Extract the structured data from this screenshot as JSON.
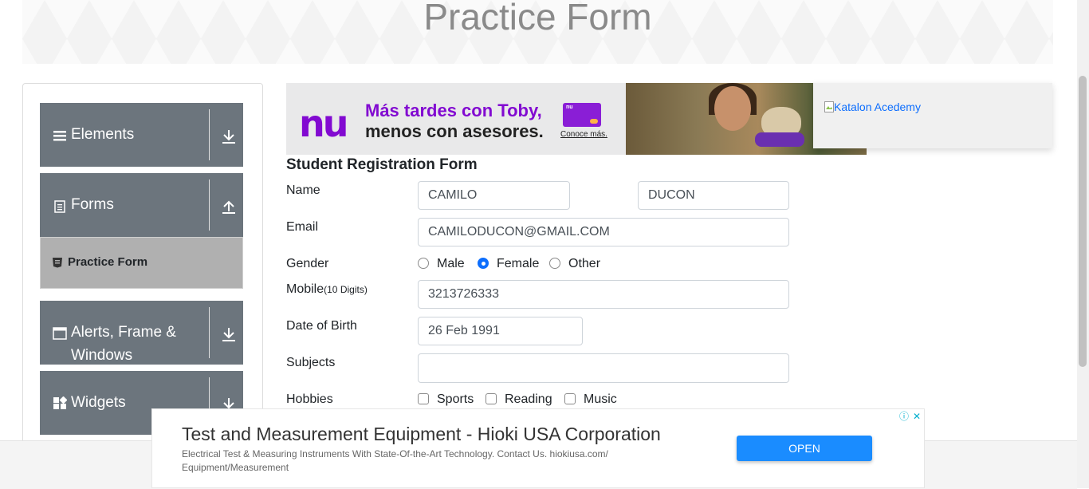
{
  "page": {
    "title": "Practice Form"
  },
  "sidebar": {
    "groups": [
      {
        "label": "Elements",
        "icon": "hamburger-icon",
        "arrow": "download-arrow-icon"
      },
      {
        "label": "Forms",
        "icon": "document-icon",
        "arrow": "upload-arrow-icon"
      },
      {
        "label": "Alerts, Frame &",
        "label2": "Windows",
        "icon": "window-icon",
        "arrow": "download-arrow-icon"
      },
      {
        "label": "Widgets",
        "icon": "widgets-icon",
        "arrow": "download-arrow-icon"
      }
    ],
    "active_item": {
      "label": "Practice Form",
      "icon": "html5-icon"
    }
  },
  "top_ad": {
    "brand": "nu",
    "line1": "Más tardes con Toby,",
    "line2": "menos con asesores.",
    "cta": "Conoce más.",
    "card_logo": "nu",
    "brand_color": "#820ad1"
  },
  "katalon": {
    "alt_text": "Katalon Acedemy"
  },
  "form": {
    "title": "Student Registration Form",
    "labels": {
      "name": "Name",
      "email": "Email",
      "gender": "Gender",
      "mobile": "Mobile",
      "mobile_hint": "(10 Digits)",
      "dob": "Date of Birth",
      "subjects": "Subjects",
      "hobbies": "Hobbies"
    },
    "first_name": "CAMILO",
    "last_name": "DUCON",
    "email": "CAMILODUCON@GMAIL.COM",
    "gender_options": [
      "Male",
      "Female",
      "Other"
    ],
    "gender_selected": "Female",
    "mobile": "3213726333",
    "dob": "26 Feb 1991",
    "subjects": "",
    "hobbies": [
      "Sports",
      "Reading",
      "Music"
    ],
    "accent": "#0d6efd"
  },
  "bottom_ad": {
    "title": "Test and Measurement Equipment - Hioki USA Corporation",
    "description": "Electrical Test & Measuring Instruments With State-Of-the-Art Technology. Contact Us. hiokiusa.com/ Equipment/Measurement",
    "button": "OPEN",
    "button_color": "#1a8cff",
    "adchoices_icons": [
      "info-icon",
      "close-icon"
    ]
  }
}
